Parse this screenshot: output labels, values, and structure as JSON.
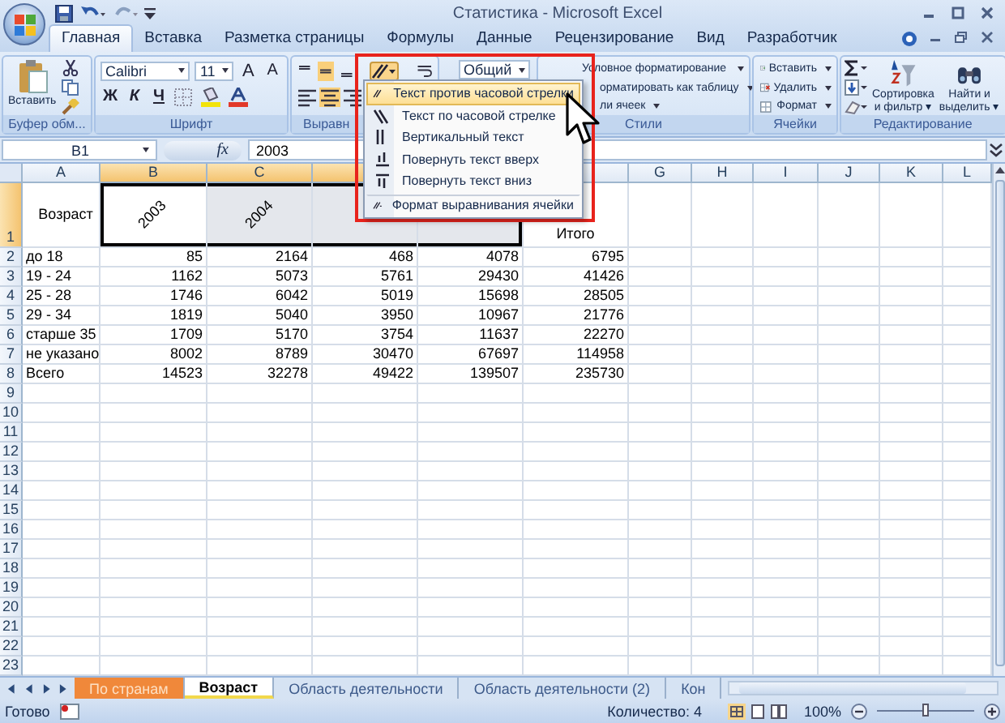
{
  "window": {
    "title": "Статистика - Microsoft Excel"
  },
  "ribbon_tabs": [
    {
      "label": "Главная",
      "selected": true
    },
    {
      "label": "Вставка",
      "selected": false
    },
    {
      "label": "Разметка страницы",
      "selected": false
    },
    {
      "label": "Формулы",
      "selected": false
    },
    {
      "label": "Данные",
      "selected": false
    },
    {
      "label": "Рецензирование",
      "selected": false
    },
    {
      "label": "Вид",
      "selected": false
    },
    {
      "label": "Разработчик",
      "selected": false
    }
  ],
  "ribbon": {
    "clipboard": {
      "paste": "Вставить",
      "label": "Буфер обм..."
    },
    "font": {
      "name": "Calibri",
      "size": "11",
      "grow": "A",
      "shrink": "A",
      "bold": "Ж",
      "italic": "К",
      "underline": "Ч",
      "label": "Шрифт"
    },
    "alignment": {
      "label": "Выравн",
      "valign_buttons": [
        {
          "selected": false
        },
        {
          "selected": true
        },
        {
          "selected": false
        }
      ],
      "halign_buttons": [
        {
          "selected": false
        },
        {
          "selected": true
        },
        {
          "selected": false
        }
      ],
      "orientation_pressed": true
    },
    "number": {
      "format": "Общий"
    },
    "styles": {
      "items": [
        "Условное форматирование",
        "орматировать как таблицу",
        "ли ячеек"
      ],
      "label": "Стили"
    },
    "cells": {
      "items": [
        "Вставить",
        "Удалить",
        "Формат"
      ],
      "label": "Ячейки"
    },
    "editing": {
      "sort": [
        "Сортировка",
        "и фильтр ▾"
      ],
      "find": [
        "Найти и",
        "выделить ▾"
      ],
      "label": "Редактирование"
    }
  },
  "orientation_menu": [
    {
      "label": "Текст против часовой стрелки",
      "selected": true
    },
    {
      "label": "Текст по часовой стрелке",
      "selected": false
    },
    {
      "label": "Вертикальный текст",
      "selected": false
    },
    {
      "label": "Повернуть текст вверх",
      "selected": false
    },
    {
      "label": "Повернуть текст вниз",
      "selected": false
    },
    {
      "label": "Формат выравнивания ячейки",
      "selected": false
    }
  ],
  "formula_bar": {
    "name_box": "B1",
    "fx": "fx",
    "formula": "2003"
  },
  "columns": [
    {
      "label": "A",
      "selected": false
    },
    {
      "label": "B",
      "selected": true
    },
    {
      "label": "C",
      "selected": true
    },
    {
      "selected": true
    },
    {},
    {
      "selected": false
    },
    {
      "label": "G",
      "selected": false
    },
    {
      "label": "H",
      "selected": false
    },
    {
      "label": "I",
      "selected": false
    },
    {
      "label": "J",
      "selected": false
    },
    {
      "label": "K",
      "selected": false
    },
    {
      "label": "L",
      "selected": false
    }
  ],
  "rows": [
    {
      "label": "1",
      "selected": true,
      "kind": "header",
      "cells": [
        {
          "text": "Возраст",
          "rotated": false,
          "selected": false
        },
        {
          "text": "2003",
          "rotated": true,
          "selected": true
        },
        {
          "text": "2004",
          "rotated": true,
          "selected": true
        },
        {
          "selected": true
        },
        {
          "selected": true
        },
        {
          "text": "Итого",
          "rotated": false,
          "selected": false
        }
      ]
    },
    {
      "label": "2",
      "selected": false,
      "kind": "data",
      "cells": [
        "до 18",
        "85",
        "2164",
        "468",
        "4078",
        "6795"
      ]
    },
    {
      "label": "3",
      "selected": false,
      "kind": "data",
      "cells": [
        "19 - 24",
        "1162",
        "5073",
        "5761",
        "29430",
        "41426"
      ]
    },
    {
      "label": "4",
      "selected": false,
      "kind": "data",
      "cells": [
        "25 - 28",
        "1746",
        "6042",
        "5019",
        "15698",
        "28505"
      ]
    },
    {
      "label": "5",
      "selected": false,
      "kind": "data",
      "cells": [
        "29 - 34",
        "1819",
        "5040",
        "3950",
        "10967",
        "21776"
      ]
    },
    {
      "label": "6",
      "selected": false,
      "kind": "data",
      "cells": [
        "старше 35",
        "1709",
        "5170",
        "3754",
        "11637",
        "22270"
      ]
    },
    {
      "label": "7",
      "selected": false,
      "kind": "data",
      "cells": [
        "не указано",
        "8002",
        "8789",
        "30470",
        "67697",
        "114958"
      ]
    },
    {
      "label": "8",
      "selected": false,
      "kind": "data",
      "cells": [
        "Всего",
        "14523",
        "32278",
        "49422",
        "139507",
        "235730"
      ]
    },
    {
      "label": "9",
      "selected": false,
      "kind": "data"
    },
    {
      "label": "10",
      "selected": false,
      "kind": "data"
    },
    {
      "label": "11",
      "selected": false,
      "kind": "data"
    },
    {
      "label": "12",
      "selected": false,
      "kind": "data"
    },
    {
      "label": "13",
      "selected": false,
      "kind": "data"
    },
    {
      "label": "14",
      "selected": false,
      "kind": "data"
    },
    {
      "label": "15",
      "selected": false,
      "kind": "data"
    },
    {
      "label": "16",
      "selected": false,
      "kind": "data"
    },
    {
      "label": "17",
      "selected": false,
      "kind": "data"
    },
    {
      "label": "18",
      "selected": false,
      "kind": "data"
    },
    {
      "label": "19",
      "selected": false,
      "kind": "data"
    },
    {
      "label": "20",
      "selected": false,
      "kind": "data"
    },
    {
      "label": "21",
      "selected": false,
      "kind": "data"
    },
    {
      "label": "22",
      "selected": false,
      "kind": "data"
    },
    {
      "label": "23",
      "selected": false,
      "kind": "data"
    }
  ],
  "sheet_tabs": [
    {
      "label": "По странам",
      "selected": false,
      "color": "#f0883a"
    },
    {
      "label": "Возраст",
      "selected": true
    },
    {
      "label": "Область деятельности",
      "selected": false
    },
    {
      "label": "Область деятельности (2)",
      "selected": false
    },
    {
      "label": "Кон",
      "selected": false
    }
  ],
  "status_bar": {
    "status": "Готово",
    "count": "Количество: 4",
    "zoom": "100%",
    "zoom_level": {
      "level": 0.5
    }
  }
}
